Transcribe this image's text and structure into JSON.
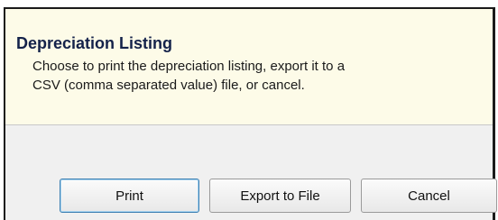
{
  "dialog": {
    "title": "Depreciation Listing",
    "message_line1": "Choose to print the depreciation listing, export it to a",
    "message_line2": "CSV (comma separated value) file, or cancel."
  },
  "buttons": {
    "print_label": "Print",
    "export_label": "Export to File",
    "cancel_label": "Cancel"
  },
  "colors": {
    "header_background": "#fdfbe8",
    "footer_background": "#f0f0f0",
    "title_text": "#14224a",
    "default_button_border": "#3c7fb1"
  }
}
